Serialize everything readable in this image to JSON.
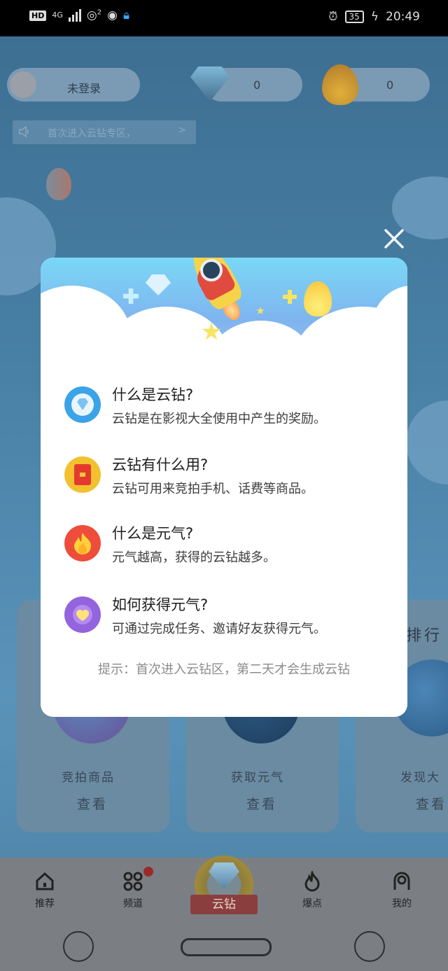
{
  "status_bar": {
    "hd_label": "HD",
    "network": "4G",
    "hotspot_count": "2",
    "battery": "35",
    "time": "20:49"
  },
  "header": {
    "login_label": "未登录",
    "diamond_count": "0",
    "energy_count": "0"
  },
  "notice": {
    "text": "首次进入云钻专区，",
    "arrow": ">"
  },
  "cards": [
    {
      "title": "竞拍商品",
      "button": "查看"
    },
    {
      "title": "获取元气",
      "button": "查看"
    },
    {
      "title": "发现大",
      "button": "查看"
    }
  ],
  "ranking_partial": "排行",
  "dialog": {
    "faq": [
      {
        "question": "什么是云钻?",
        "answer": "云钻是在影视大全使用中产生的奖励。",
        "icon": "diamond-icon",
        "color": "#3ba3e8"
      },
      {
        "question": "云钻有什么用?",
        "answer": "云钻可用来竞拍手机、话费等商品。",
        "icon": "red-envelope-icon",
        "color": "#f3c02f"
      },
      {
        "question": "什么是元气?",
        "answer": "元气越高，获得的云钻越多。",
        "icon": "fire-icon",
        "color": "#ee4d3b"
      },
      {
        "question": "如何获得元气?",
        "answer": "可通过完成任务、邀请好友获得元气。",
        "icon": "heart-icon",
        "color": "#9463de"
      }
    ],
    "hint": "提示：首次进入云钻区，第二天才会生成云钻"
  },
  "bottom_nav": {
    "items": [
      {
        "label": "推荐",
        "icon": "home-icon"
      },
      {
        "label": "频道",
        "icon": "channels-icon"
      },
      {
        "label": "云钻",
        "icon": "diamond-icon"
      },
      {
        "label": "爆点",
        "icon": "flame-icon"
      },
      {
        "label": "我的",
        "icon": "profile-icon"
      }
    ]
  }
}
